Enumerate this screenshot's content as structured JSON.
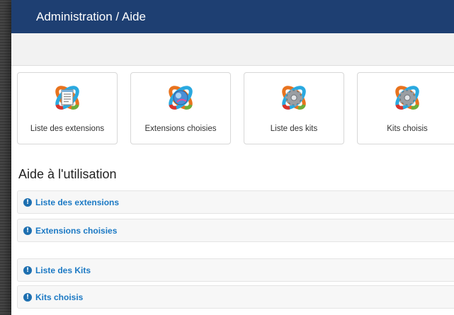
{
  "window": {
    "title": "Administration / Aide"
  },
  "tiles": [
    {
      "label": "Liste des extensions",
      "icon": "extensions-list-icon"
    },
    {
      "label": "Extensions choisies",
      "icon": "extensions-chosen-icon"
    },
    {
      "label": "Liste des kits",
      "icon": "kits-list-icon"
    },
    {
      "label": "Kits choisis",
      "icon": "kits-chosen-icon"
    }
  ],
  "help": {
    "title": "Aide à l'utilisation",
    "items": [
      {
        "label": "Liste des extensions"
      },
      {
        "label": "Extensions choisies"
      },
      {
        "label": "Liste des Kits"
      },
      {
        "label": "Kits choisis"
      }
    ]
  },
  "colors": {
    "titlebar": "#1e3f72",
    "link": "#1b79c4",
    "info_icon": "#1d6fb0"
  }
}
